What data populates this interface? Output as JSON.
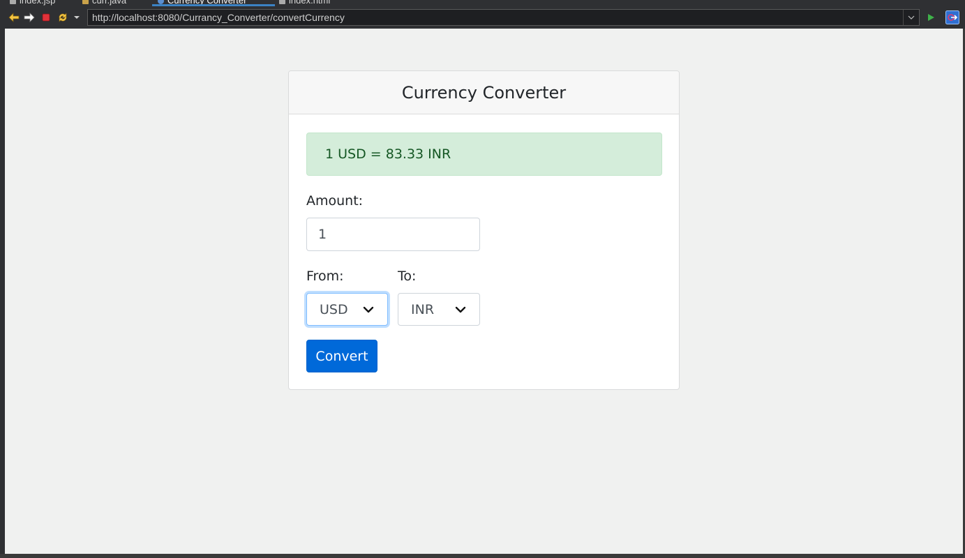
{
  "browser": {
    "tabs": [
      {
        "label": "index.jsp"
      },
      {
        "label": "curr.java"
      },
      {
        "label": "Currency Converter"
      },
      {
        "label": "index.html"
      }
    ],
    "address": "http://localhost:8080/Currancy_Converter/convertCurrency",
    "icons": {
      "back": "arrow-left-icon",
      "forward": "arrow-right-icon",
      "stop": "stop-icon",
      "refresh": "refresh-icon",
      "menu": "dropdown-icon",
      "go": "play-icon",
      "open_external": "open-external-icon"
    }
  },
  "card": {
    "title": "Currency Converter",
    "result": "1 USD = 83.33 INR"
  },
  "form": {
    "amount_label": "Amount:",
    "amount_value": "1",
    "from_label": "From:",
    "from_value": "USD",
    "to_label": "To:",
    "to_value": "INR",
    "convert_label": "Convert"
  },
  "colors": {
    "success_bg": "#d4edda",
    "success_text": "#155724",
    "primary": "#0069d9"
  }
}
